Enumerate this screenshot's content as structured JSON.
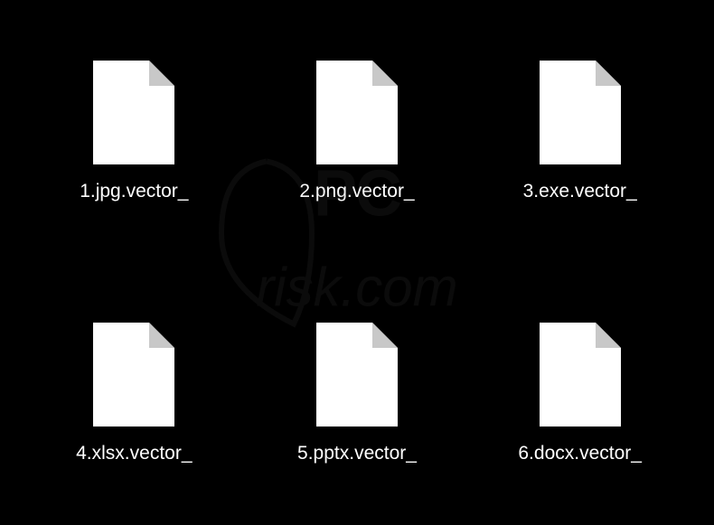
{
  "files": [
    {
      "label": "1.jpg.vector_"
    },
    {
      "label": "2.png.vector_"
    },
    {
      "label": "3.exe.vector_"
    },
    {
      "label": "4.xlsx.vector_"
    },
    {
      "label": "5.pptx.vector_"
    },
    {
      "label": "6.docx.vector_"
    }
  ],
  "watermark_text": "pcrisk.com"
}
